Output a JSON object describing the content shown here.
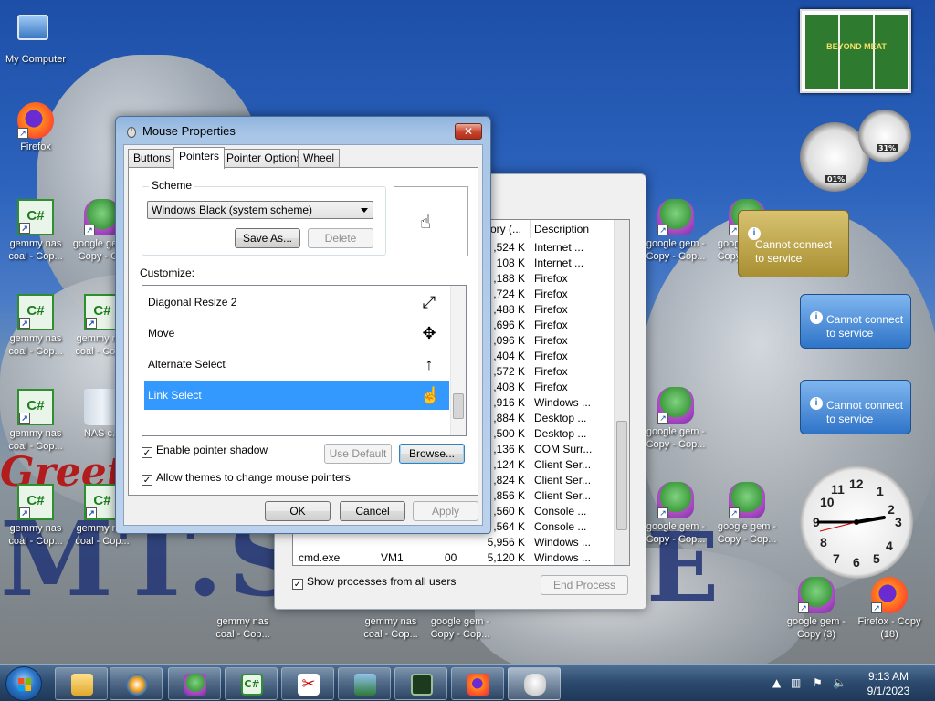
{
  "desktop": {
    "greeting_text": "Greetin",
    "mountain_text": "MT.S",
    "mountain_text_end": "E",
    "icons": [
      {
        "label": "My Computer",
        "kind": "computer-icon"
      },
      {
        "label": "Firefox",
        "kind": "firefox-icon"
      },
      {
        "label": "gemmy nas coal - Cop...",
        "kind": "csharp-icon"
      },
      {
        "label": "google gem - Copy - C...",
        "kind": "frog-icon"
      },
      {
        "label": "gemmy nas coal - Cop...",
        "kind": "csharp-icon"
      },
      {
        "label": "gemmy nas coal - Cop...",
        "kind": "csharp-icon"
      },
      {
        "label": "gemmy nas coal - Cop...",
        "kind": "csharp-icon"
      },
      {
        "label": "NAS c...",
        "kind": "recycle-bin-icon"
      },
      {
        "label": "gemmy nas coal - Cop...",
        "kind": "csharp-icon"
      },
      {
        "label": "gemmy nas coal - Cop...",
        "kind": "csharp-icon"
      },
      {
        "label": "gemmy nas coal - Cop...",
        "kind": "csharp-icon"
      },
      {
        "label": "gemmy nas coal - Cop...",
        "kind": "csharp-icon"
      },
      {
        "label": "google gem - Copy - Cop...",
        "kind": "frog-icon"
      },
      {
        "label": "google gem - Copy - Cop...",
        "kind": "frog-icon"
      },
      {
        "label": "google gem - Copy - Cop...",
        "kind": "frog-icon"
      },
      {
        "label": "google gem - Copy - Cop...",
        "kind": "frog-icon"
      },
      {
        "label": "google gem - Copy - Cop...",
        "kind": "frog-icon"
      },
      {
        "label": "google gem - Copy - Cop...",
        "kind": "frog-icon"
      },
      {
        "label": "google gem - Copy - Cop...",
        "kind": "frog-icon"
      },
      {
        "label": "google gem - Copy (3)",
        "kind": "frog-icon"
      },
      {
        "label": "Firefox - Copy (18)",
        "kind": "firefox-icon"
      }
    ]
  },
  "gadgets": {
    "cpu_percent": "01%",
    "mem_percent": "31%",
    "weather_message": "Cannot connect to service",
    "feed_message_1": "Cannot connect to service",
    "feed_message_2": "Cannot connect to service",
    "slideshow_caption": "BEYOND MEAT",
    "clock_numbers": [
      "12",
      "1",
      "2",
      "3",
      "4",
      "5",
      "6",
      "7",
      "8",
      "9",
      "10",
      "11"
    ]
  },
  "task_manager": {
    "headers": [
      "ory (...",
      "Description"
    ],
    "rows": [
      {
        "image": "",
        "user": "",
        "cpu": "",
        "mem": ",524 K",
        "desc": "Internet ..."
      },
      {
        "image": "",
        "user": "",
        "cpu": "",
        "mem": "108 K",
        "desc": "Internet ..."
      },
      {
        "image": "",
        "user": "",
        "cpu": "",
        "mem": ",188 K",
        "desc": "Firefox"
      },
      {
        "image": "",
        "user": "",
        "cpu": "",
        "mem": ",724 K",
        "desc": "Firefox"
      },
      {
        "image": "",
        "user": "",
        "cpu": "",
        "mem": ",488 K",
        "desc": "Firefox"
      },
      {
        "image": "",
        "user": "",
        "cpu": "",
        "mem": ",696 K",
        "desc": "Firefox"
      },
      {
        "image": "",
        "user": "",
        "cpu": "",
        "mem": ",096 K",
        "desc": "Firefox"
      },
      {
        "image": "",
        "user": "",
        "cpu": "",
        "mem": ",404 K",
        "desc": "Firefox"
      },
      {
        "image": "",
        "user": "",
        "cpu": "",
        "mem": ",572 K",
        "desc": "Firefox"
      },
      {
        "image": "",
        "user": "",
        "cpu": "",
        "mem": ",408 K",
        "desc": "Firefox"
      },
      {
        "image": "",
        "user": "",
        "cpu": "",
        "mem": ",916 K",
        "desc": "Windows ..."
      },
      {
        "image": "",
        "user": "",
        "cpu": "",
        "mem": ",884 K",
        "desc": "Desktop ..."
      },
      {
        "image": "",
        "user": "",
        "cpu": "",
        "mem": ",500 K",
        "desc": "Desktop ..."
      },
      {
        "image": "",
        "user": "",
        "cpu": "",
        "mem": ",136 K",
        "desc": "COM Surr..."
      },
      {
        "image": "",
        "user": "",
        "cpu": "",
        "mem": ",124 K",
        "desc": "Client Ser..."
      },
      {
        "image": "",
        "user": "",
        "cpu": "",
        "mem": ",824 K",
        "desc": "Client Ser..."
      },
      {
        "image": "",
        "user": "",
        "cpu": "",
        "mem": ",856 K",
        "desc": "Client Ser..."
      },
      {
        "image": "",
        "user": "",
        "cpu": "",
        "mem": ",560 K",
        "desc": "Console ..."
      },
      {
        "image": "",
        "user": "",
        "cpu": "",
        "mem": ",564 K",
        "desc": "Console ..."
      },
      {
        "image": "",
        "user": "",
        "cpu": "",
        "mem": "5,956 K",
        "desc": "Windows ..."
      },
      {
        "image": "cmd.exe",
        "user": "VM1",
        "cpu": "00",
        "mem": "5,120 K",
        "desc": "Windows ..."
      }
    ],
    "show_all_label": "Show processes from all users",
    "end_process_label": "End Process"
  },
  "mouse_properties": {
    "title": "Mouse Properties",
    "tabs": [
      "Buttons",
      "Pointers",
      "Pointer Options",
      "Wheel"
    ],
    "scheme_group": "Scheme",
    "scheme_value": "Windows Black (system scheme)",
    "save_as_label": "Save As...",
    "delete_label": "Delete",
    "customize_label": "Customize:",
    "items": [
      {
        "name": "Diagonal Resize 2",
        "glyph": "⤢"
      },
      {
        "name": "Move",
        "glyph": "✥"
      },
      {
        "name": "Alternate Select",
        "glyph": "↑"
      },
      {
        "name": "Link Select",
        "glyph": "☝"
      }
    ],
    "enable_shadow_label": "Enable pointer shadow",
    "use_default_label": "Use Default",
    "browse_label": "Browse...",
    "allow_themes_label": "Allow themes to change mouse pointers",
    "ok_label": "OK",
    "cancel_label": "Cancel",
    "apply_label": "Apply"
  },
  "taskbar": {
    "time": "9:13 AM",
    "date": "9/1/2023"
  }
}
